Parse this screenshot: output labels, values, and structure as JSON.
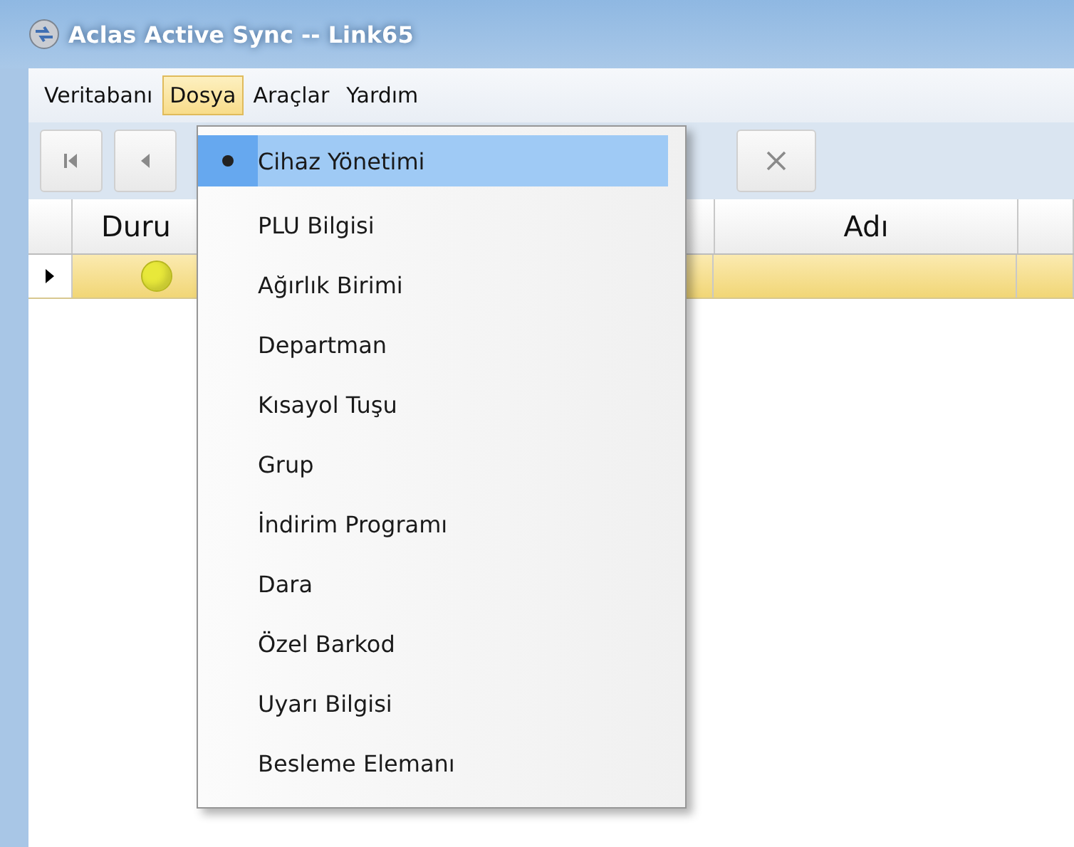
{
  "window": {
    "title": "Aclas Active Sync -- Link65"
  },
  "menubar": [
    {
      "label": "Veritabanı",
      "selected": false
    },
    {
      "label": "Dosya",
      "selected": true
    },
    {
      "label": "Araçlar",
      "selected": false
    },
    {
      "label": "Yardım",
      "selected": false
    }
  ],
  "toolbar": [
    {
      "kind": "first"
    },
    {
      "kind": "prev"
    },
    {
      "kind": "cancel"
    }
  ],
  "table": {
    "columns": [
      "Duru",
      "Adı"
    ],
    "rows": [
      {
        "selected": true,
        "color": "#e8e83a"
      }
    ]
  },
  "menu": {
    "items": [
      {
        "label": "Cihaz Yönetimi",
        "selected": true,
        "checked": true
      },
      {
        "label": "PLU Bilgisi",
        "selected": false,
        "checked": false
      },
      {
        "label": "Ağırlık Birimi",
        "selected": false,
        "checked": false
      },
      {
        "label": "Departman",
        "selected": false,
        "checked": false
      },
      {
        "label": "Kısayol Tuşu",
        "selected": false,
        "checked": false
      },
      {
        "label": "Grup",
        "selected": false,
        "checked": false
      },
      {
        "label": "İndirim Programı",
        "selected": false,
        "checked": false
      },
      {
        "label": "Dara",
        "selected": false,
        "checked": false
      },
      {
        "label": "Özel Barkod",
        "selected": false,
        "checked": false
      },
      {
        "label": "Uyarı Bilgisi",
        "selected": false,
        "checked": false
      },
      {
        "label": "Besleme Elemanı",
        "selected": false,
        "checked": false
      }
    ]
  }
}
